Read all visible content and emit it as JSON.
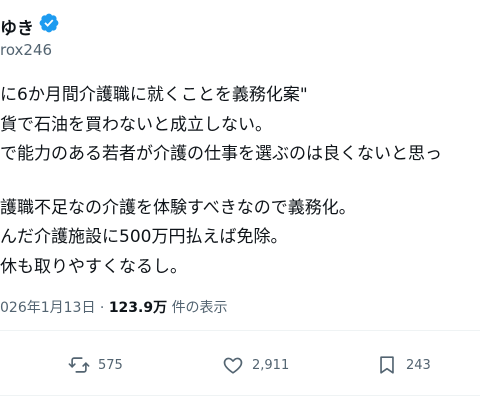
{
  "author": {
    "name": "ゆき",
    "handle": "rox246"
  },
  "tweet": {
    "lines": [
      "に6か月間介護職に就くことを義務化案\"",
      "貨で石油を買わないと成立しない。",
      "で能力のある若者が介護の仕事を選ぶのは良くないと思っ",
      "護職不足なの介護を体験すべきなので義務化。",
      "んだ介護施設に500万円払えば免除。",
      "休も取りやすくなるし。"
    ]
  },
  "meta": {
    "date": "026年1月13日",
    "dot": "·",
    "views": "123.9万",
    "views_suffix": "件の表示"
  },
  "actions": {
    "retweets": "575",
    "likes": "2,911",
    "bookmarks": "243"
  },
  "colors": {
    "accent": "#1d9bf0",
    "text": "#0f1419",
    "muted": "#536471"
  },
  "icons": [
    "verified-badge-icon",
    "retweet-icon",
    "heart-icon",
    "bookmark-icon"
  ]
}
